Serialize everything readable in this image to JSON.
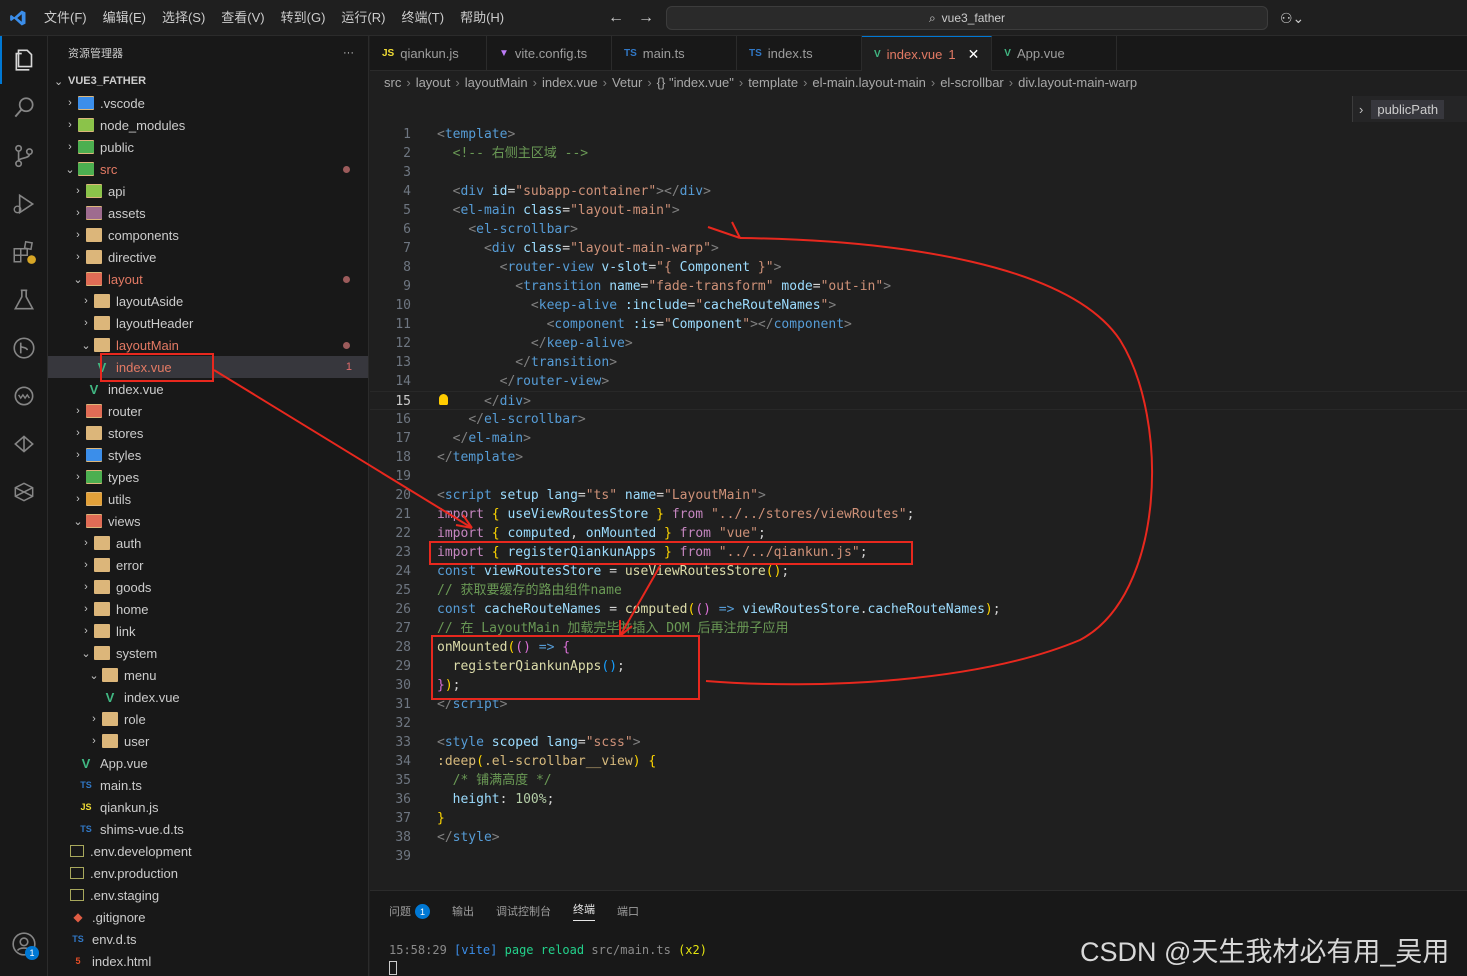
{
  "titlebar": {
    "menu": [
      "文件(F)",
      "编辑(E)",
      "选择(S)",
      "查看(V)",
      "转到(G)",
      "运行(R)",
      "终端(T)",
      "帮助(H)"
    ],
    "search": "vue3_father",
    "copilot": "⚇⌄"
  },
  "explorer": {
    "title": "资源管理器",
    "more": "···",
    "project": "VUE3_FATHER",
    "items": [
      {
        "label": ".vscode",
        "depth": 0,
        "kind": "folder",
        "chev": "›",
        "color": "#3b8eea"
      },
      {
        "label": "node_modules",
        "depth": 0,
        "kind": "folder",
        "chev": "›",
        "color": "#8bc34a"
      },
      {
        "label": "public",
        "depth": 0,
        "kind": "folder",
        "chev": "›",
        "color": "#4caf50"
      },
      {
        "label": "src",
        "depth": 0,
        "kind": "folder",
        "chev": "⌄",
        "color": "#4caf50",
        "modified": true
      },
      {
        "label": "api",
        "depth": 1,
        "kind": "folder",
        "chev": "›",
        "color": "#8bc34a"
      },
      {
        "label": "assets",
        "depth": 1,
        "kind": "folder",
        "chev": "›",
        "color": "#9e6b8f"
      },
      {
        "label": "components",
        "depth": 1,
        "kind": "folder",
        "chev": "›",
        "color": "#dcb67a"
      },
      {
        "label": "directive",
        "depth": 1,
        "kind": "folder",
        "chev": "›",
        "color": "#dcb67a"
      },
      {
        "label": "layout",
        "depth": 1,
        "kind": "folder",
        "chev": "⌄",
        "color": "#e06c55",
        "modified": true
      },
      {
        "label": "layoutAside",
        "depth": 2,
        "kind": "folder",
        "chev": "›",
        "color": "#dcb67a"
      },
      {
        "label": "layoutHeader",
        "depth": 2,
        "kind": "folder",
        "chev": "›",
        "color": "#dcb67a"
      },
      {
        "label": "layoutMain",
        "depth": 2,
        "kind": "folder",
        "chev": "⌄",
        "color": "#dcb67a",
        "modified": true
      },
      {
        "label": "index.vue",
        "depth": 3,
        "kind": "vue",
        "chev": "",
        "modified": true,
        "count": "1",
        "selected": true
      },
      {
        "label": "index.vue",
        "depth": 2,
        "kind": "vue",
        "chev": ""
      },
      {
        "label": "router",
        "depth": 1,
        "kind": "folder",
        "chev": "›",
        "color": "#e06c55"
      },
      {
        "label": "stores",
        "depth": 1,
        "kind": "folder",
        "chev": "›",
        "color": "#dcb67a"
      },
      {
        "label": "styles",
        "depth": 1,
        "kind": "folder",
        "chev": "›",
        "color": "#3b8eea"
      },
      {
        "label": "types",
        "depth": 1,
        "kind": "folder",
        "chev": "›",
        "color": "#4caf50"
      },
      {
        "label": "utils",
        "depth": 1,
        "kind": "folder",
        "chev": "›",
        "color": "#e2a13a"
      },
      {
        "label": "views",
        "depth": 1,
        "kind": "folder",
        "chev": "⌄",
        "color": "#e06c55"
      },
      {
        "label": "auth",
        "depth": 2,
        "kind": "folder",
        "chev": "›",
        "color": "#dcb67a"
      },
      {
        "label": "error",
        "depth": 2,
        "kind": "folder",
        "chev": "›",
        "color": "#dcb67a"
      },
      {
        "label": "goods",
        "depth": 2,
        "kind": "folder",
        "chev": "›",
        "color": "#dcb67a"
      },
      {
        "label": "home",
        "depth": 2,
        "kind": "folder",
        "chev": "›",
        "color": "#dcb67a"
      },
      {
        "label": "link",
        "depth": 2,
        "kind": "folder",
        "chev": "›",
        "color": "#dcb67a"
      },
      {
        "label": "system",
        "depth": 2,
        "kind": "folder",
        "chev": "⌄",
        "color": "#dcb67a"
      },
      {
        "label": "menu",
        "depth": 3,
        "kind": "folder",
        "chev": "⌄",
        "color": "#dcb67a"
      },
      {
        "label": "index.vue",
        "depth": 4,
        "kind": "vue",
        "chev": ""
      },
      {
        "label": "role",
        "depth": 3,
        "kind": "folder",
        "chev": "›",
        "color": "#dcb67a"
      },
      {
        "label": "user",
        "depth": 3,
        "kind": "folder",
        "chev": "›",
        "color": "#dcb67a"
      },
      {
        "label": "App.vue",
        "depth": 1,
        "kind": "vue",
        "chev": ""
      },
      {
        "label": "main.ts",
        "depth": 1,
        "kind": "ts",
        "chev": ""
      },
      {
        "label": "qiankun.js",
        "depth": 1,
        "kind": "js",
        "chev": ""
      },
      {
        "label": "shims-vue.d.ts",
        "depth": 1,
        "kind": "ts",
        "chev": ""
      },
      {
        "label": ".env.development",
        "depth": 0,
        "kind": "env",
        "chev": ""
      },
      {
        "label": ".env.production",
        "depth": 0,
        "kind": "env",
        "chev": ""
      },
      {
        "label": ".env.staging",
        "depth": 0,
        "kind": "env",
        "chev": ""
      },
      {
        "label": ".gitignore",
        "depth": 0,
        "kind": "git",
        "chev": ""
      },
      {
        "label": "env.d.ts",
        "depth": 0,
        "kind": "ts",
        "chev": ""
      },
      {
        "label": "index.html",
        "depth": 0,
        "kind": "html",
        "chev": ""
      }
    ]
  },
  "tabs": [
    {
      "icon": "JS",
      "icon_color": "#f1dd35",
      "label": "qiankun.js"
    },
    {
      "icon": "▼",
      "icon_color": "#bd7cf7",
      "label": "vite.config.ts"
    },
    {
      "icon": "TS",
      "icon_color": "#3178c6",
      "label": "main.ts"
    },
    {
      "icon": "TS",
      "icon_color": "#3178c6",
      "label": "index.ts"
    },
    {
      "icon": "V",
      "icon_color": "#41b883",
      "label": "index.vue",
      "count": "1",
      "active": true
    },
    {
      "icon": "V",
      "icon_color": "#41b883",
      "label": "App.vue"
    }
  ],
  "breadcrumb": [
    "src",
    "layout",
    "layoutMain",
    "index.vue",
    "Vetur",
    "{} \"index.vue\"",
    "template",
    "el-main.layout-main",
    "el-scrollbar",
    "div.layout-main-warp"
  ],
  "sticky": "publicPath",
  "code": [
    [
      [
        "c-br",
        "<"
      ],
      [
        "c-tag",
        "template"
      ],
      [
        "c-br",
        ">"
      ]
    ],
    [
      [
        "c-p",
        "  "
      ],
      [
        "c-cmt",
        "<!-- 右侧主区域 -->"
      ]
    ],
    [],
    [
      [
        "c-p",
        "  "
      ],
      [
        "c-br",
        "<"
      ],
      [
        "c-tag",
        "div"
      ],
      [
        "c-p",
        " "
      ],
      [
        "c-attr",
        "id"
      ],
      [
        "c-p",
        "="
      ],
      [
        "c-str",
        "\"subapp-container\""
      ],
      [
        "c-br",
        "></"
      ],
      [
        "c-tag",
        "div"
      ],
      [
        "c-br",
        ">"
      ]
    ],
    [
      [
        "c-p",
        "  "
      ],
      [
        "c-br",
        "<"
      ],
      [
        "c-tag",
        "el-main"
      ],
      [
        "c-p",
        " "
      ],
      [
        "c-attr",
        "class"
      ],
      [
        "c-p",
        "="
      ],
      [
        "c-str",
        "\"layout-main\""
      ],
      [
        "c-br",
        ">"
      ]
    ],
    [
      [
        "c-p",
        "    "
      ],
      [
        "c-br",
        "<"
      ],
      [
        "c-tag",
        "el-scrollbar"
      ],
      [
        "c-br",
        ">"
      ]
    ],
    [
      [
        "c-p",
        "      "
      ],
      [
        "c-br",
        "<"
      ],
      [
        "c-tag",
        "div"
      ],
      [
        "c-p",
        " "
      ],
      [
        "c-attr",
        "class"
      ],
      [
        "c-p",
        "="
      ],
      [
        "c-str",
        "\"layout-main-warp\""
      ],
      [
        "c-br",
        ">"
      ]
    ],
    [
      [
        "c-p",
        "        "
      ],
      [
        "c-br",
        "<"
      ],
      [
        "c-tag",
        "router-view"
      ],
      [
        "c-p",
        " "
      ],
      [
        "c-attr",
        "v-slot"
      ],
      [
        "c-p",
        "="
      ],
      [
        "c-str",
        "\"{ "
      ],
      [
        "c-var",
        "Component"
      ],
      [
        "c-str",
        " }\""
      ],
      [
        "c-br",
        ">"
      ]
    ],
    [
      [
        "c-p",
        "          "
      ],
      [
        "c-br",
        "<"
      ],
      [
        "c-tag",
        "transition"
      ],
      [
        "c-p",
        " "
      ],
      [
        "c-attr",
        "name"
      ],
      [
        "c-p",
        "="
      ],
      [
        "c-str",
        "\"fade-transform\""
      ],
      [
        "c-p",
        " "
      ],
      [
        "c-attr",
        "mode"
      ],
      [
        "c-p",
        "="
      ],
      [
        "c-str",
        "\"out-in\""
      ],
      [
        "c-br",
        ">"
      ]
    ],
    [
      [
        "c-p",
        "            "
      ],
      [
        "c-br",
        "<"
      ],
      [
        "c-tag",
        "keep-alive"
      ],
      [
        "c-p",
        " "
      ],
      [
        "c-attr",
        ":include"
      ],
      [
        "c-p",
        "="
      ],
      [
        "c-str",
        "\""
      ],
      [
        "c-var",
        "cacheRouteNames"
      ],
      [
        "c-str",
        "\""
      ],
      [
        "c-br",
        ">"
      ]
    ],
    [
      [
        "c-p",
        "              "
      ],
      [
        "c-br",
        "<"
      ],
      [
        "c-tag",
        "component"
      ],
      [
        "c-p",
        " "
      ],
      [
        "c-attr",
        ":is"
      ],
      [
        "c-p",
        "="
      ],
      [
        "c-str",
        "\""
      ],
      [
        "c-var",
        "Component"
      ],
      [
        "c-str",
        "\""
      ],
      [
        "c-br",
        "></"
      ],
      [
        "c-tag",
        "component"
      ],
      [
        "c-br",
        ">"
      ]
    ],
    [
      [
        "c-p",
        "            "
      ],
      [
        "c-br",
        "</"
      ],
      [
        "c-tag",
        "keep-alive"
      ],
      [
        "c-br",
        ">"
      ]
    ],
    [
      [
        "c-p",
        "          "
      ],
      [
        "c-br",
        "</"
      ],
      [
        "c-tag",
        "transition"
      ],
      [
        "c-br",
        ">"
      ]
    ],
    [
      [
        "c-p",
        "        "
      ],
      [
        "c-br",
        "</"
      ],
      [
        "c-tag",
        "router-view"
      ],
      [
        "c-br",
        ">"
      ]
    ],
    [
      [
        "c-p",
        "      "
      ],
      [
        "c-br",
        "</"
      ],
      [
        "c-tag",
        "div"
      ],
      [
        "c-br",
        ">"
      ]
    ],
    [
      [
        "c-p",
        "    "
      ],
      [
        "c-br",
        "</"
      ],
      [
        "c-tag",
        "el-scrollbar"
      ],
      [
        "c-br",
        ">"
      ]
    ],
    [
      [
        "c-p",
        "  "
      ],
      [
        "c-br",
        "</"
      ],
      [
        "c-tag",
        "el-main"
      ],
      [
        "c-br",
        ">"
      ]
    ],
    [
      [
        "c-br",
        "</"
      ],
      [
        "c-tag",
        "template"
      ],
      [
        "c-br",
        ">"
      ]
    ],
    [],
    [
      [
        "c-br",
        "<"
      ],
      [
        "c-tag",
        "script"
      ],
      [
        "c-p",
        " "
      ],
      [
        "c-attr",
        "setup"
      ],
      [
        "c-p",
        " "
      ],
      [
        "c-attr",
        "lang"
      ],
      [
        "c-p",
        "="
      ],
      [
        "c-str",
        "\"ts\""
      ],
      [
        "c-p",
        " "
      ],
      [
        "c-attr",
        "name"
      ],
      [
        "c-p",
        "="
      ],
      [
        "c-str",
        "\"LayoutMain\""
      ],
      [
        "c-br",
        ">"
      ]
    ],
    [
      [
        "c-kw",
        "import"
      ],
      [
        "c-p",
        " "
      ],
      [
        "c-brk",
        "{"
      ],
      [
        "c-p",
        " "
      ],
      [
        "c-var",
        "useViewRoutesStore"
      ],
      [
        "c-p",
        " "
      ],
      [
        "c-brk",
        "}"
      ],
      [
        "c-p",
        " "
      ],
      [
        "c-kw",
        "from"
      ],
      [
        "c-p",
        " "
      ],
      [
        "c-str",
        "\"../../stores/viewRoutes\""
      ],
      [
        "c-p",
        ";"
      ]
    ],
    [
      [
        "c-kw",
        "import"
      ],
      [
        "c-p",
        " "
      ],
      [
        "c-brk",
        "{"
      ],
      [
        "c-p",
        " "
      ],
      [
        "c-var",
        "computed"
      ],
      [
        "c-p",
        ", "
      ],
      [
        "c-var",
        "onMounted"
      ],
      [
        "c-p",
        " "
      ],
      [
        "c-brk",
        "}"
      ],
      [
        "c-p",
        " "
      ],
      [
        "c-kw",
        "from"
      ],
      [
        "c-p",
        " "
      ],
      [
        "c-str",
        "\"vue\""
      ],
      [
        "c-p",
        ";"
      ]
    ],
    [
      [
        "c-kw",
        "import"
      ],
      [
        "c-p",
        " "
      ],
      [
        "c-brk",
        "{"
      ],
      [
        "c-p",
        " "
      ],
      [
        "c-var",
        "registerQiankunApps"
      ],
      [
        "c-p",
        " "
      ],
      [
        "c-brk",
        "}"
      ],
      [
        "c-p",
        " "
      ],
      [
        "c-kw",
        "from"
      ],
      [
        "c-p",
        " "
      ],
      [
        "c-str",
        "\"../../qiankun.js\""
      ],
      [
        "c-p",
        ";"
      ]
    ],
    [
      [
        "c-kw2",
        "const"
      ],
      [
        "c-p",
        " "
      ],
      [
        "c-var",
        "viewRoutesStore"
      ],
      [
        "c-p",
        " = "
      ],
      [
        "c-fn",
        "useViewRoutesStore"
      ],
      [
        "c-brk",
        "()"
      ],
      [
        "c-p",
        ";"
      ]
    ],
    [
      [
        "c-cmt",
        "// 获取要缓存的路由组件name"
      ]
    ],
    [
      [
        "c-kw2",
        "const"
      ],
      [
        "c-p",
        " "
      ],
      [
        "c-var",
        "cacheRouteNames"
      ],
      [
        "c-p",
        " = "
      ],
      [
        "c-fn",
        "computed"
      ],
      [
        "c-brk",
        "("
      ],
      [
        "c-brk2",
        "()"
      ],
      [
        "c-p",
        " "
      ],
      [
        "c-kw2",
        "=>"
      ],
      [
        "c-p",
        " "
      ],
      [
        "c-var",
        "viewRoutesStore"
      ],
      [
        "c-p",
        "."
      ],
      [
        "c-var",
        "cacheRouteNames"
      ],
      [
        "c-brk",
        ")"
      ],
      [
        "c-p",
        ";"
      ]
    ],
    [
      [
        "c-cmt",
        "// 在 LayoutMain 加载完毕并插入 DOM 后再注册子应用"
      ]
    ],
    [
      [
        "c-fn",
        "onMounted"
      ],
      [
        "c-brk",
        "("
      ],
      [
        "c-brk2",
        "()"
      ],
      [
        "c-p",
        " "
      ],
      [
        "c-kw2",
        "=>"
      ],
      [
        "c-p",
        " "
      ],
      [
        "c-brk2",
        "{"
      ]
    ],
    [
      [
        "c-p",
        "  "
      ],
      [
        "c-fn",
        "registerQiankunApps"
      ],
      [
        "c-brk3",
        "()"
      ],
      [
        "c-p",
        ";"
      ]
    ],
    [
      [
        "c-brk2",
        "}"
      ],
      [
        "c-brk",
        ")"
      ],
      [
        "c-p",
        ";"
      ]
    ],
    [
      [
        "c-br",
        "</"
      ],
      [
        "c-tag",
        "script"
      ],
      [
        "c-br",
        ">"
      ]
    ],
    [],
    [
      [
        "c-br",
        "<"
      ],
      [
        "c-tag",
        "style"
      ],
      [
        "c-p",
        " "
      ],
      [
        "c-attr",
        "scoped"
      ],
      [
        "c-p",
        " "
      ],
      [
        "c-attr",
        "lang"
      ],
      [
        "c-p",
        "="
      ],
      [
        "c-str",
        "\"scss\""
      ],
      [
        "c-br",
        ">"
      ]
    ],
    [
      [
        "c-sel",
        ":deep"
      ],
      [
        "c-brk",
        "("
      ],
      [
        "c-sel",
        ".el-scrollbar__view"
      ],
      [
        "c-brk",
        ")"
      ],
      [
        "c-p",
        " "
      ],
      [
        "c-brk",
        "{"
      ]
    ],
    [
      [
        "c-p",
        "  "
      ],
      [
        "c-cmt",
        "/* 铺满高度 */"
      ]
    ],
    [
      [
        "c-p",
        "  "
      ],
      [
        "c-attr",
        "height"
      ],
      [
        "c-p",
        ": "
      ],
      [
        "c-num",
        "100%"
      ],
      [
        "c-p",
        ";"
      ]
    ],
    [
      [
        "c-brk",
        "}"
      ]
    ],
    [
      [
        "c-br",
        "</"
      ],
      [
        "c-tag",
        "style"
      ],
      [
        "c-br",
        ">"
      ]
    ],
    []
  ],
  "current_line": 15,
  "panel": {
    "tabs": [
      "问题",
      "输出",
      "调试控制台",
      "终端",
      "端口"
    ],
    "problems_count": "1",
    "active_tab": "终端",
    "terminal": {
      "time": "15:58:29",
      "tag": "[vite]",
      "msg": "page reload",
      "path": "src/main.ts",
      "count": "(x2)"
    }
  },
  "watermark": "CSDN @天生我材必有用_吴用",
  "accounts_badge": "1",
  "colors": {
    "accent": "#0078d4",
    "annotation": "#e8281e",
    "modified": "#e37a64"
  }
}
